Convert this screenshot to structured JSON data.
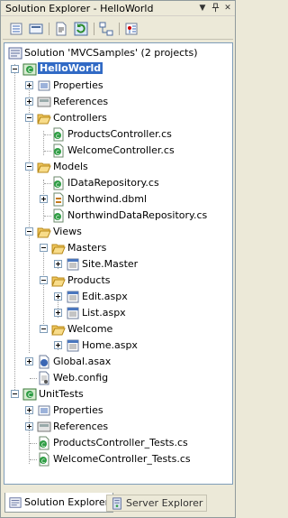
{
  "window": {
    "title": "Solution Explorer - HelloWorld"
  },
  "titlebar_icons": [
    "dropdown-arrow-icon",
    "pin-icon",
    "close-icon"
  ],
  "toolbar": {
    "buttons": [
      "properties-icon",
      "show-all-files-icon",
      "refresh-icon",
      "view-code-icon",
      "view-designer-icon",
      "class-diagram-icon"
    ]
  },
  "tree": {
    "solution": "Solution 'MVCSamples' (2 projects)",
    "project1": "HelloWorld",
    "properties": "Properties",
    "references": "References",
    "controllers": "Controllers",
    "products_controller": "ProductsController.cs",
    "welcome_controller": "WelcomeController.cs",
    "models": "Models",
    "idatarepo": "IDataRepository.cs",
    "northwind_dbml": "Northwind.dbml",
    "northwind_repo": "NorthwindDataRepository.cs",
    "views": "Views",
    "masters": "Masters",
    "site_master": "Site.Master",
    "products": "Products",
    "edit_aspx": "Edit.aspx",
    "list_aspx": "List.aspx",
    "welcome": "Welcome",
    "home_aspx": "Home.aspx",
    "global_asax": "Global.asax",
    "web_config": "Web.config",
    "project2": "UnitTests",
    "properties2": "Properties",
    "references2": "References",
    "products_tests": "ProductsController_Tests.cs",
    "welcome_tests": "WelcomeController_Tests.cs"
  },
  "tabs": {
    "solution_explorer": "Solution Explorer",
    "server_explorer": "Server Explorer"
  },
  "colors": {
    "selection": "#316ac5",
    "folder": "#f0c75e",
    "chrome": "#ece9d8"
  }
}
